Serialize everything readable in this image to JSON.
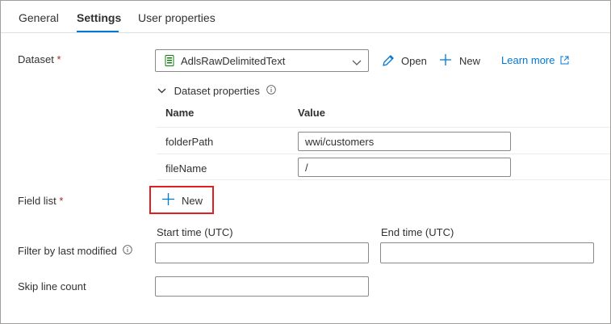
{
  "tabs": [
    {
      "label": "General",
      "active": false
    },
    {
      "label": "Settings",
      "active": true
    },
    {
      "label": "User properties",
      "active": false
    }
  ],
  "colors": {
    "accent": "#0078d4",
    "required": "#a4262c",
    "highlight_box": "#e02020"
  },
  "dataset": {
    "label": "Dataset",
    "required_mark": "*",
    "selected": "AdlsRawDelimitedText",
    "icon": "dataset-file-icon",
    "open_label": "Open",
    "new_label": "New",
    "learn_more_label": "Learn more",
    "learn_more_icon": "open-external-icon"
  },
  "dataset_properties": {
    "title": "Dataset properties",
    "columns": {
      "name": "Name",
      "value": "Value"
    },
    "rows": [
      {
        "name": "folderPath",
        "value": "wwi/customers"
      },
      {
        "name": "fileName",
        "value": "/"
      }
    ]
  },
  "field_list": {
    "label": "Field list",
    "required_mark": "*",
    "new_label": "New"
  },
  "filter": {
    "label": "Filter by last modified",
    "start_label": "Start time (UTC)",
    "end_label": "End time (UTC)",
    "start_value": "",
    "end_value": ""
  },
  "skip_line_count": {
    "label": "Skip line count",
    "value": ""
  }
}
